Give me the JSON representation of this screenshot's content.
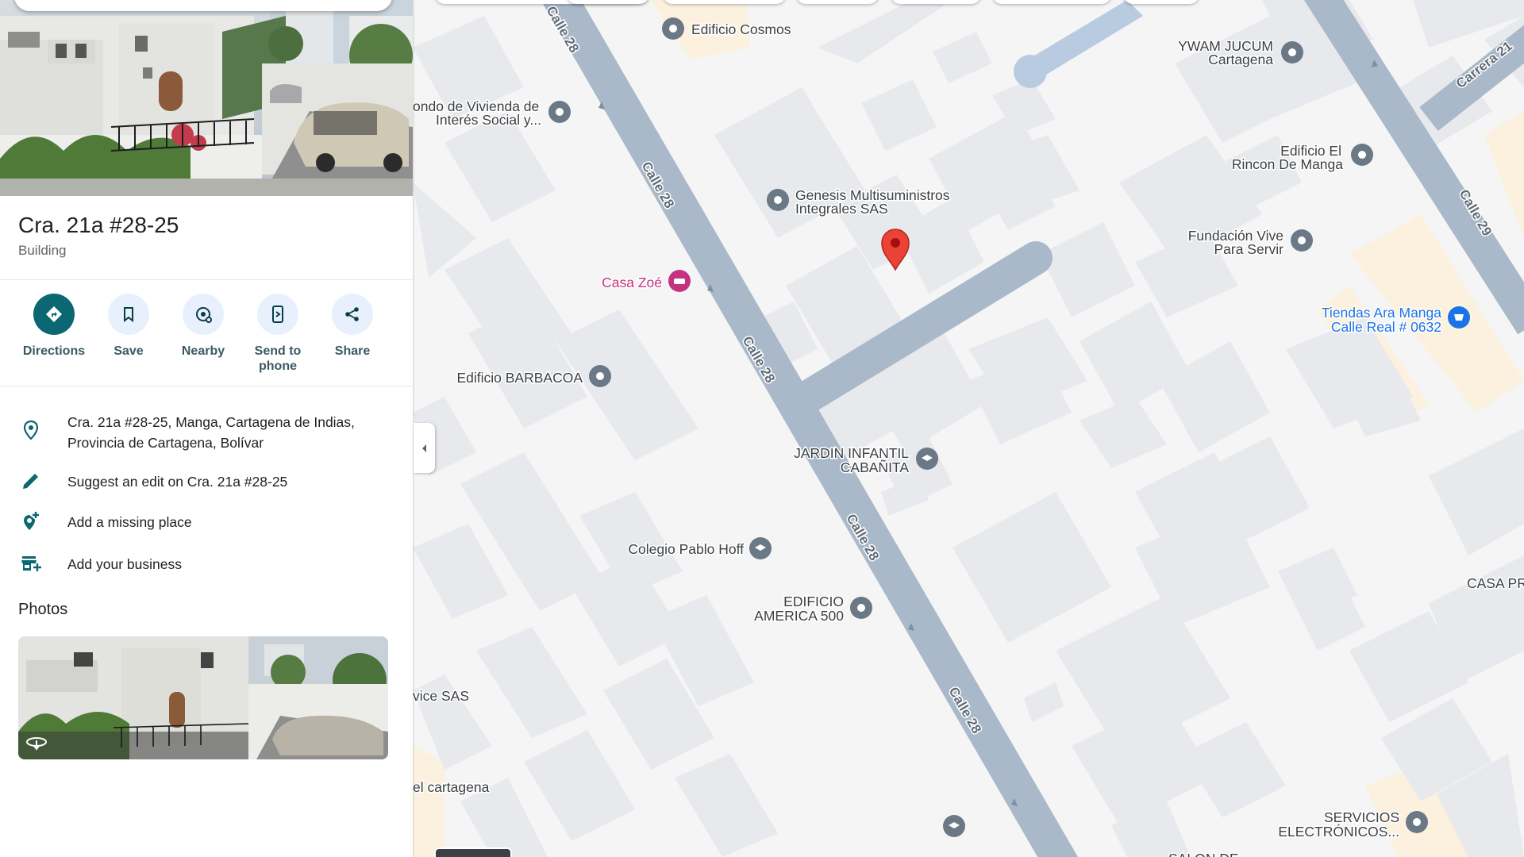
{
  "place": {
    "title": "Cra. 21a #28-25",
    "category": "Building"
  },
  "actions": [
    {
      "label": "Directions",
      "icon": "directions-icon"
    },
    {
      "label": "Save",
      "icon": "bookmark-icon"
    },
    {
      "label": "Nearby",
      "icon": "nearby-icon"
    },
    {
      "label": "Send to\nphone",
      "icon": "phone-icon"
    },
    {
      "label": "Share",
      "icon": "share-icon"
    }
  ],
  "info": {
    "address": "Cra. 21a #28-25, Manga, Cartagena de Indias,\nProvincia de Cartagena, Bolívar",
    "suggest_edit": "Suggest an edit on Cra. 21a #28-25",
    "add_missing": "Add a missing place",
    "add_business": "Add your business"
  },
  "photos": {
    "heading": "Photos"
  },
  "map": {
    "streets": {
      "s1": "Calle 28",
      "s2": "Calle 28",
      "s3": "Calle 28",
      "s4": "Calle 28",
      "s5": "Calle 29",
      "s6": "Carrera 21"
    },
    "places": {
      "p1": "Edificio Cosmos",
      "p2": "YWAM JUCUM\nCartagena",
      "p3": "ondo de Vivienda de\nInterés Social y...",
      "p4": "Edificio El\nRincon De Manga",
      "p5": "Genesis Multisuministros\nIntegrales SAS",
      "p6": "Fundación Vive\nPara Servir",
      "p7": "Casa Zoé",
      "p8": "Tiendas Ara Manga\nCalle Real # 0632",
      "p9": "Edificio BARBACOA",
      "p10": "JARDIN INFANTIL\nCABAÑITA",
      "p11": "Colegio Pablo Hoff",
      "p12": "CASA PR",
      "p13": "EDIFICIO\nAMERICA 500",
      "p14": "vice SAS",
      "p15": "el cartagena",
      "p16": "SERVICIOS\nELECTRÓNICOS...",
      "p17": "SALON DE"
    }
  },
  "colors": {
    "primary": "#0b6771",
    "action_bg": "#e8f0fe",
    "road": "#aab9c9",
    "map_bg": "#f5f5f5",
    "building": "#e8e9ed",
    "marker": "#ea4335",
    "poi_pink": "#c5327f",
    "poi_blue": "#1a73e8"
  }
}
